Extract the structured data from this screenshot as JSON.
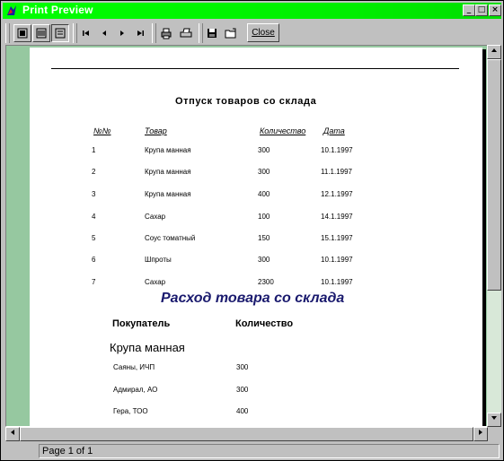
{
  "window": {
    "title": "Print Preview",
    "min_glyph": "_",
    "max_glyph": "□",
    "close_glyph": "×"
  },
  "toolbar": {
    "close_label": "Close"
  },
  "status": {
    "page_text": "Page 1 of 1"
  },
  "report": {
    "title": "Отпуск товаров со склада",
    "columns": [
      "№№",
      "Товар",
      "Количество",
      "Дата"
    ],
    "rows": [
      [
        "1",
        "Крупа манная",
        "300",
        "10.1.1997"
      ],
      [
        "2",
        "Крупа манная",
        "300",
        "11.1.1997"
      ],
      [
        "3",
        "Крупа манная",
        "400",
        "12.1.1997"
      ],
      [
        "4",
        "Сахар",
        "100",
        "14.1.1997"
      ],
      [
        "5",
        "Соус томатный",
        "150",
        "15.1.1997"
      ],
      [
        "6",
        "Шпроты",
        "300",
        "10.1.1997"
      ],
      [
        "7",
        "Сахар",
        "2300",
        "10.1.1997"
      ]
    ],
    "section2_title": "Расход товара со склада",
    "section2_columns": [
      "Покупатель",
      "Количество"
    ],
    "group_name": "Крупа манная",
    "group_rows": [
      [
        "Саяны, ИЧП",
        "300"
      ],
      [
        "Адмирал, АО",
        "300"
      ],
      [
        "Гера, ТОО",
        "400"
      ]
    ]
  },
  "colors": {
    "titlebar": "#00ff00",
    "workspace": "#96c8a0",
    "section2_title": "#1a1a6e"
  }
}
